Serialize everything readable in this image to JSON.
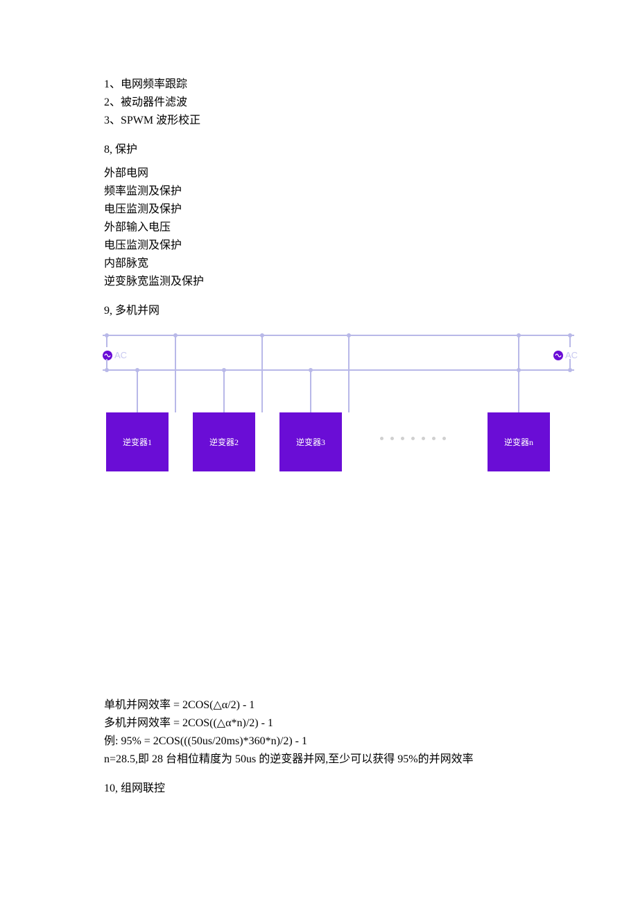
{
  "list1": {
    "i1": "1、电网频率跟踪",
    "i2": "2、被动器件滤波",
    "i3": "3、SPWM 波形校正"
  },
  "section8": {
    "heading": "8, 保护",
    "lines": {
      "l1": "外部电网",
      "l2": "频率监测及保护",
      "l3": "电压监测及保护",
      "l4": "外部输入电压",
      "l5": "电压监测及保护",
      "l6": "内部脉宽",
      "l7": "逆变脉宽监测及保护"
    }
  },
  "section9": {
    "heading": "9, 多机并网",
    "diagram": {
      "ac_label": "AC",
      "inverters": {
        "b1": "逆变器1",
        "b2": "逆变器2",
        "b3": "逆变器3",
        "bn": "逆变器n"
      }
    },
    "formulas": {
      "f1": "单机并网效率  = 2COS(△α/2) - 1",
      "f2": "多机并网效率  = 2COS((△α*n)/2) - 1",
      "f3": "例: 95% = 2COS(((50us/20ms)*360*n)/2) - 1",
      "f4": "n=28.5,即 28 台相位精度为 50us 的逆变器并网,至少可以获得 95%的并网效率"
    }
  },
  "section10": {
    "heading": "10, 组网联控"
  }
}
